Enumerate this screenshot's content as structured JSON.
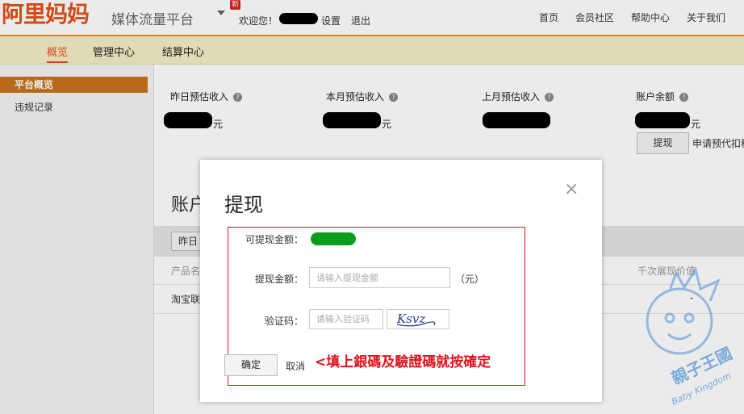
{
  "header": {
    "logo": "阿里妈妈",
    "platform": "媒体流量平台",
    "new_badge": "新",
    "welcome": "欢迎您！",
    "settings": "设置",
    "logout": "退出",
    "nav": [
      "首页",
      "会员社区",
      "帮助中心",
      "关于我们"
    ]
  },
  "subnav": [
    "概览",
    "管理中心",
    "结算中心"
  ],
  "sidebar": {
    "active": "平台概览",
    "items": [
      "违规记录"
    ]
  },
  "stats": {
    "items": [
      {
        "label": "昨日预估收入",
        "unit": "元"
      },
      {
        "label": "本月预估收入",
        "unit": "元"
      },
      {
        "label": "上月预估收入",
        "unit": ""
      },
      {
        "label": "账户余额",
        "unit": "元"
      }
    ],
    "withdraw_button": "提现",
    "apply_text": "申请预代扣税"
  },
  "background": {
    "section_title": "账户",
    "date_button": "昨日",
    "col_product": "产品名",
    "col_cpm": "千次展现价值",
    "row_product": "淘宝联",
    "row_value": "-"
  },
  "modal": {
    "title": "提现",
    "close": "×",
    "available_label": "可提现金额：",
    "amount_label": "提现金额：",
    "amount_placeholder": "请输入提现金额",
    "amount_unit": "（元）",
    "captcha_label": "验证码：",
    "captcha_placeholder": "请输入验证码",
    "captcha_text": "Ksvz",
    "confirm": "确定",
    "cancel": "取消",
    "annotation": "<填上銀碼及驗證碼就按確定"
  },
  "watermark": {
    "title": "親子王國",
    "subtitle": "Baby Kingdom"
  },
  "colors": {
    "brand": "#e3511b",
    "accent_bar": "#c8741d",
    "annotation": "#e0141c",
    "redaction_green": "#0a9c1f"
  }
}
